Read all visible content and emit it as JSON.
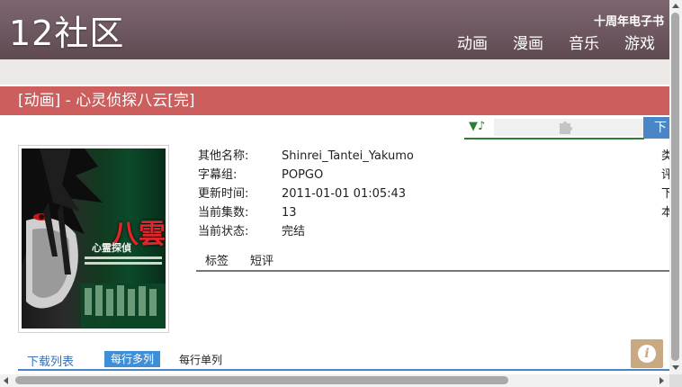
{
  "header": {
    "logo": "12社区",
    "top_link": "十周年电子书",
    "nav": [
      "动画",
      "漫画",
      "音乐",
      "游戏"
    ]
  },
  "title_bar": {
    "text": "[动画] - 心灵侦探八云[完]",
    "color": "#cd5e5e"
  },
  "player": {
    "icon": "music-note-icon",
    "plugin_icon": "puzzle-plugin-icon",
    "download_tab": "下"
  },
  "cover": {
    "overlay_title": "八雲",
    "overlay_subtitle": "心霊探偵"
  },
  "info": {
    "rows": [
      {
        "label": "其他名称:",
        "value": "Shinrei_Tantei_Yakumo"
      },
      {
        "label": "字幕组:",
        "value": "POPGO"
      },
      {
        "label": "更新时间:",
        "value": "2011-01-01 01:05:43"
      },
      {
        "label": "当前集数:",
        "value": "13"
      },
      {
        "label": "当前状态:",
        "value": "完结"
      }
    ],
    "right_column": [
      "类",
      "评",
      "下",
      "本"
    ]
  },
  "tabs": [
    "标签",
    "短评"
  ],
  "download_list": {
    "title": "下载列表",
    "multi_label": "每行多列",
    "single_label": "每行单列"
  },
  "info_button_icon": "info-icon"
}
